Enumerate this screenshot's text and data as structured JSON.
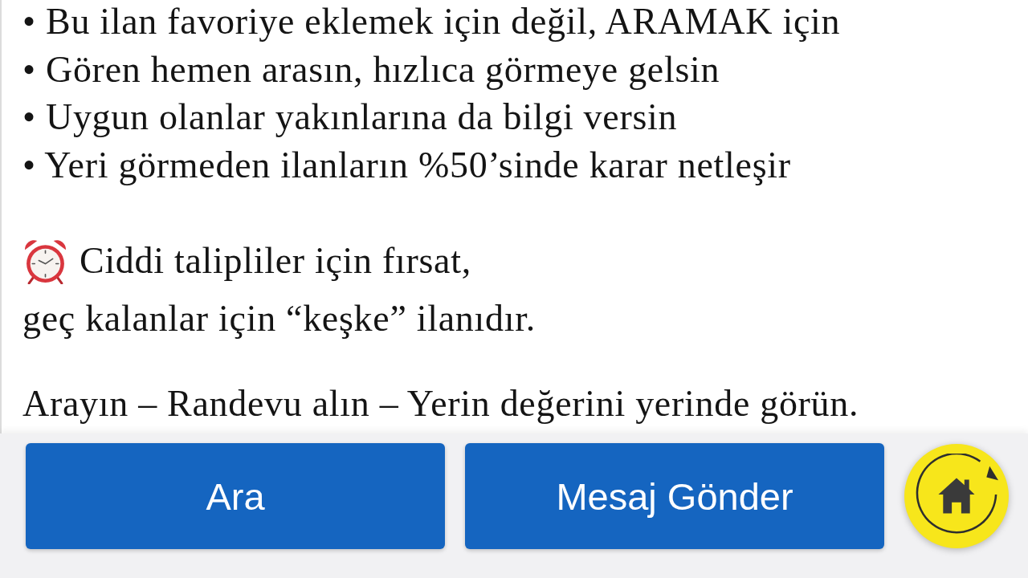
{
  "bullets": [
    "• Bu ilan favoriye eklemek için değil, ARAMAK için",
    "• Gören hemen arasın, hızlıca görmeye gelsin",
    "• Uygun olanlar yakınlarına da bilgi versin",
    "• Yeri görmeden ilanların %50’sinde karar netleşir"
  ],
  "note": {
    "lines": [
      "Ciddi talipliler için fırsat,",
      "geç kalanlar için “keşke” ilanıdır."
    ]
  },
  "call_to_action": "Arayın – Randevu alın – Yerin değerini yerinde görün.",
  "buttons": [
    {
      "label": "Ara"
    },
    {
      "label": "Mesaj Gönder"
    }
  ]
}
